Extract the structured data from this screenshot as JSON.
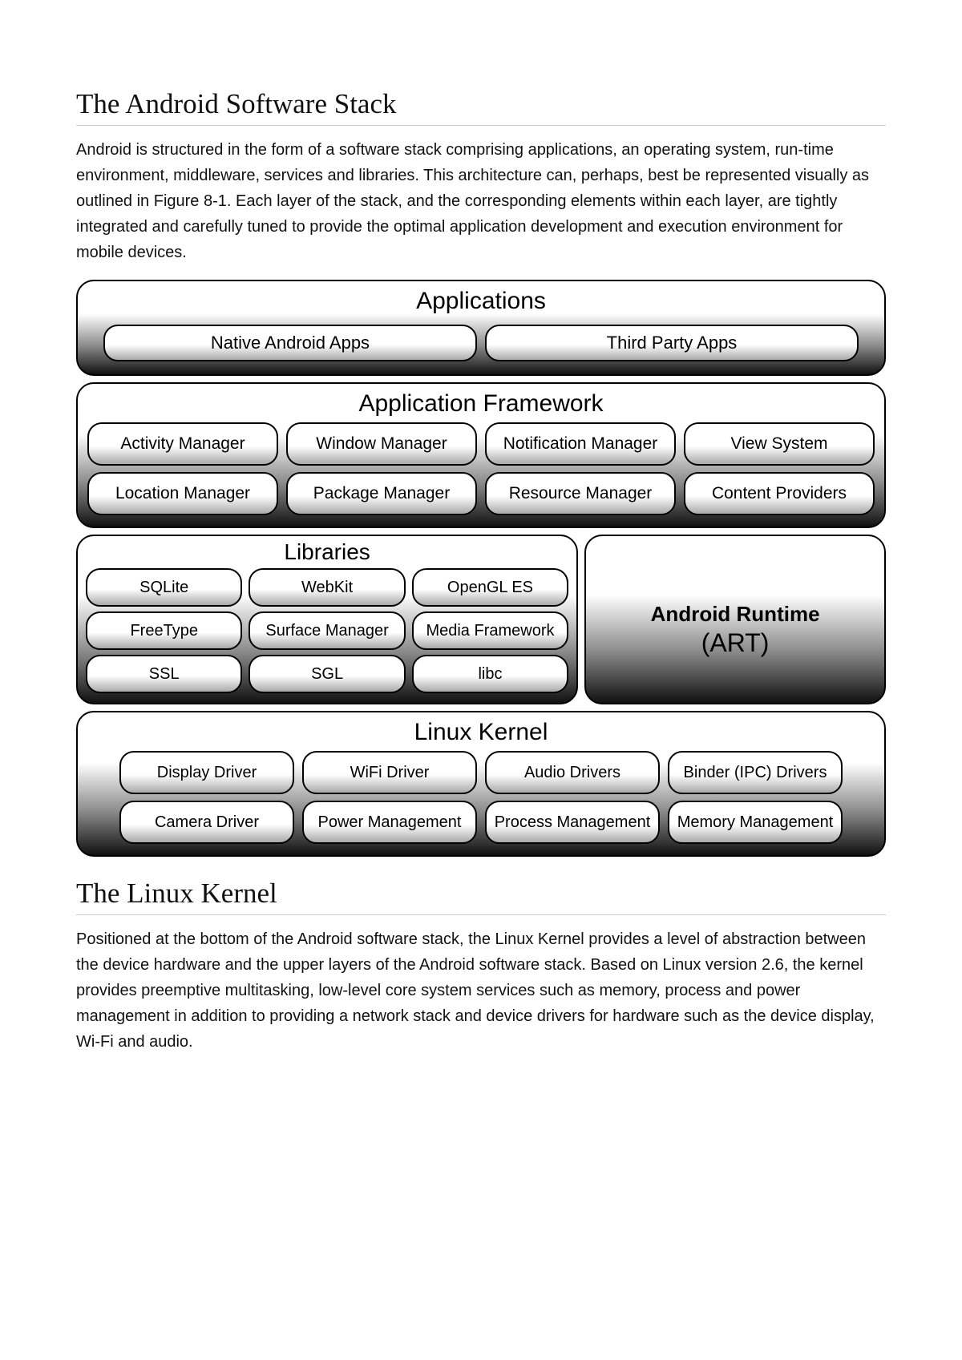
{
  "heading1": "The Android Software Stack",
  "para1": "Android is structured in the form of a software stack comprising applications, an operating system, run-time environment, middleware, services and libraries. This architecture can, perhaps, best be represented visually as outlined in Figure 8-1. Each layer of the stack, and the corresponding elements within each layer, are tightly integrated and carefully tuned to provide the optimal application development and execution environment for mobile devices.",
  "diagram": {
    "applications": {
      "title": "Applications",
      "items": [
        "Native Android Apps",
        "Third Party Apps"
      ]
    },
    "framework": {
      "title": "Application Framework",
      "row1": [
        "Activity Manager",
        "Window Manager",
        "Notification Manager",
        "View System"
      ],
      "row2": [
        "Location Manager",
        "Package Manager",
        "Resource Manager",
        "Content Providers"
      ]
    },
    "libraries": {
      "title": "Libraries",
      "row1": [
        "SQLite",
        "WebKit",
        "OpenGL ES"
      ],
      "row2": [
        "FreeType",
        "Surface Manager",
        "Media Framework"
      ],
      "row3": [
        "SSL",
        "SGL",
        "libc"
      ]
    },
    "runtime": {
      "line1": "Android Runtime",
      "line2": "(ART)"
    },
    "kernel": {
      "title": "Linux Kernel",
      "row1": [
        "Display Driver",
        "WiFi Driver",
        "Audio Drivers",
        "Binder (IPC) Drivers"
      ],
      "row2": [
        "Camera Driver",
        "Power Management",
        "Process Management",
        "Memory Management"
      ]
    }
  },
  "heading2": "The Linux Kernel",
  "para2": "Positioned at the bottom of the Android software stack, the Linux Kernel provides a level of abstraction between the device hardware and the upper layers of the Android software stack. Based on Linux version 2.6, the kernel provides preemptive multitasking, low-level core system services such as memory, process and power management in addition to providing a network stack and device drivers for hardware such as the device display, Wi-Fi and audio."
}
